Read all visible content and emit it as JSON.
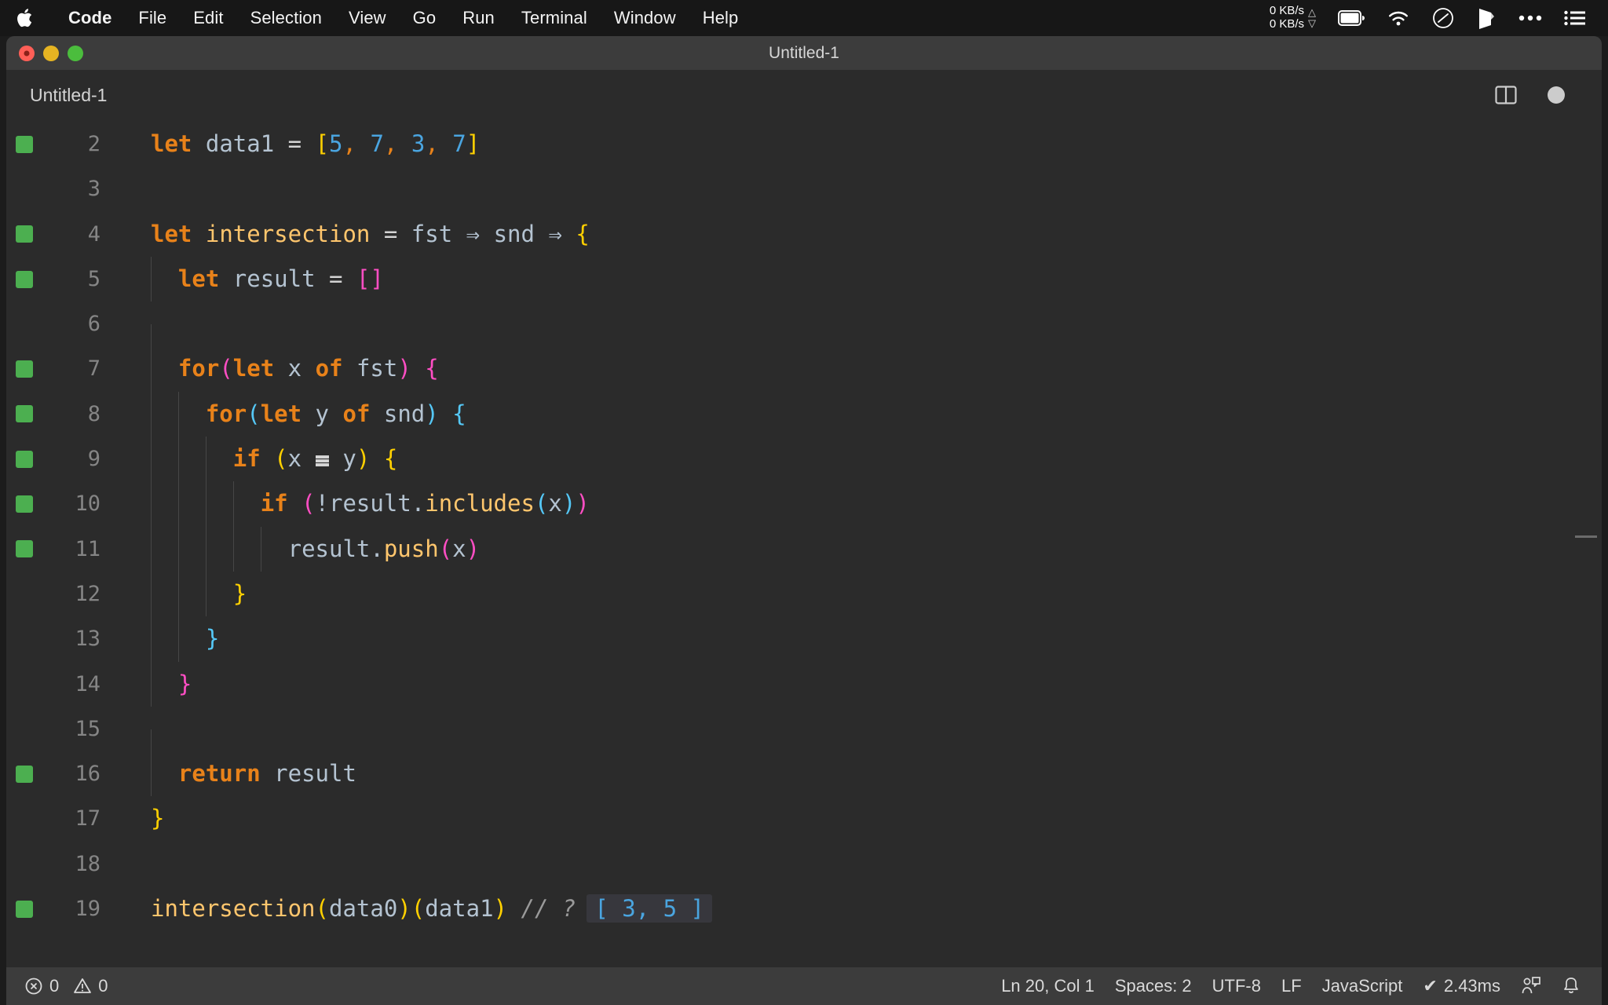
{
  "menubar": {
    "apple_icon": "apple-logo-icon",
    "items": [
      {
        "label": "Code",
        "bold": true
      },
      {
        "label": "File",
        "bold": false
      },
      {
        "label": "Edit",
        "bold": false
      },
      {
        "label": "Selection",
        "bold": false
      },
      {
        "label": "View",
        "bold": false
      },
      {
        "label": "Go",
        "bold": false
      },
      {
        "label": "Run",
        "bold": false
      },
      {
        "label": "Terminal",
        "bold": false
      },
      {
        "label": "Window",
        "bold": false
      },
      {
        "label": "Help",
        "bold": false
      }
    ],
    "network": {
      "up": "0 KB/s",
      "down": "0 KB/s"
    },
    "icons": [
      "battery-icon",
      "wifi-icon",
      "control-center-icon",
      "dropbox-icon",
      "ellipsis-icon",
      "list-icon"
    ]
  },
  "window": {
    "title": "Untitled-1",
    "traffic_lights": [
      "close-button",
      "minimize-button",
      "maximize-button"
    ]
  },
  "tabbar": {
    "tabs": [
      {
        "label": "Untitled-1",
        "active": true,
        "dirty": true
      }
    ],
    "actions": [
      "split-editor-icon",
      "unsaved-indicator"
    ]
  },
  "editor": {
    "language": "JavaScript",
    "lines": [
      {
        "number": "2",
        "quokka": true,
        "indent": 0,
        "tokens": [
          {
            "t": "let",
            "c": "kw"
          },
          {
            "t": " ",
            "c": "op"
          },
          {
            "t": "data1",
            "c": "var"
          },
          {
            "t": " ",
            "c": "op"
          },
          {
            "t": "=",
            "c": "op"
          },
          {
            "t": " ",
            "c": "op"
          },
          {
            "t": "[",
            "c": "b3"
          },
          {
            "t": "5",
            "c": "num"
          },
          {
            "t": ",",
            "c": "comma"
          },
          {
            "t": " ",
            "c": "op"
          },
          {
            "t": "7",
            "c": "num"
          },
          {
            "t": ",",
            "c": "comma"
          },
          {
            "t": " ",
            "c": "op"
          },
          {
            "t": "3",
            "c": "num"
          },
          {
            "t": ",",
            "c": "comma"
          },
          {
            "t": " ",
            "c": "op"
          },
          {
            "t": "7",
            "c": "num"
          },
          {
            "t": "]",
            "c": "b3"
          }
        ]
      },
      {
        "number": "3",
        "quokka": false,
        "indent": 0,
        "tokens": []
      },
      {
        "number": "4",
        "quokka": true,
        "indent": 0,
        "tokens": [
          {
            "t": "let",
            "c": "kw"
          },
          {
            "t": " ",
            "c": "op"
          },
          {
            "t": "intersection",
            "c": "fn"
          },
          {
            "t": " ",
            "c": "op"
          },
          {
            "t": "=",
            "c": "op"
          },
          {
            "t": " ",
            "c": "op"
          },
          {
            "t": "fst",
            "c": "var"
          },
          {
            "t": " ",
            "c": "op"
          },
          {
            "t": "⇒",
            "c": "arrow-fat"
          },
          {
            "t": " ",
            "c": "op"
          },
          {
            "t": "snd",
            "c": "var"
          },
          {
            "t": " ",
            "c": "op"
          },
          {
            "t": "⇒",
            "c": "arrow-fat"
          },
          {
            "t": " ",
            "c": "op"
          },
          {
            "t": "{",
            "c": "b3"
          }
        ]
      },
      {
        "number": "5",
        "quokka": true,
        "indent": 1,
        "tokens": [
          {
            "t": "  ",
            "c": "op"
          },
          {
            "t": "let",
            "c": "kw"
          },
          {
            "t": " ",
            "c": "op"
          },
          {
            "t": "result",
            "c": "var"
          },
          {
            "t": " ",
            "c": "op"
          },
          {
            "t": "=",
            "c": "op"
          },
          {
            "t": " ",
            "c": "op"
          },
          {
            "t": "[]",
            "c": "b1"
          }
        ]
      },
      {
        "number": "6",
        "quokka": false,
        "indent": 1,
        "tokens": []
      },
      {
        "number": "7",
        "quokka": true,
        "indent": 1,
        "tokens": [
          {
            "t": "  ",
            "c": "op"
          },
          {
            "t": "for",
            "c": "kw"
          },
          {
            "t": "(",
            "c": "b1"
          },
          {
            "t": "let",
            "c": "kw"
          },
          {
            "t": " x ",
            "c": "var"
          },
          {
            "t": "of",
            "c": "kw2"
          },
          {
            "t": " ",
            "c": "op"
          },
          {
            "t": "fst",
            "c": "var"
          },
          {
            "t": ")",
            "c": "b1"
          },
          {
            "t": " ",
            "c": "op"
          },
          {
            "t": "{",
            "c": "b1"
          }
        ]
      },
      {
        "number": "8",
        "quokka": true,
        "indent": 2,
        "tokens": [
          {
            "t": "    ",
            "c": "op"
          },
          {
            "t": "for",
            "c": "kw"
          },
          {
            "t": "(",
            "c": "b2"
          },
          {
            "t": "let",
            "c": "kw"
          },
          {
            "t": " y ",
            "c": "var"
          },
          {
            "t": "of",
            "c": "kw2"
          },
          {
            "t": " ",
            "c": "op"
          },
          {
            "t": "snd",
            "c": "var"
          },
          {
            "t": ")",
            "c": "b2"
          },
          {
            "t": " ",
            "c": "op"
          },
          {
            "t": "{",
            "c": "b2"
          }
        ]
      },
      {
        "number": "9",
        "quokka": true,
        "indent": 3,
        "tokens": [
          {
            "t": "      ",
            "c": "op"
          },
          {
            "t": "if",
            "c": "kw"
          },
          {
            "t": " ",
            "c": "op"
          },
          {
            "t": "(",
            "c": "b3"
          },
          {
            "t": "x",
            "c": "var"
          },
          {
            "t": " ",
            "c": "op"
          },
          {
            "t": "===",
            "c": "eq3marker"
          },
          {
            "t": " ",
            "c": "op"
          },
          {
            "t": "y",
            "c": "var"
          },
          {
            "t": ")",
            "c": "b3"
          },
          {
            "t": " ",
            "c": "op"
          },
          {
            "t": "{",
            "c": "b3"
          }
        ]
      },
      {
        "number": "10",
        "quokka": true,
        "indent": 4,
        "tokens": [
          {
            "t": "        ",
            "c": "op"
          },
          {
            "t": "if",
            "c": "kw"
          },
          {
            "t": " ",
            "c": "op"
          },
          {
            "t": "(",
            "c": "b1"
          },
          {
            "t": "!",
            "c": "var"
          },
          {
            "t": "result",
            "c": "var"
          },
          {
            "t": ".",
            "c": "var"
          },
          {
            "t": "includes",
            "c": "fn"
          },
          {
            "t": "(",
            "c": "b2"
          },
          {
            "t": "x",
            "c": "var"
          },
          {
            "t": ")",
            "c": "b2"
          },
          {
            "t": ")",
            "c": "b1"
          }
        ]
      },
      {
        "number": "11",
        "quokka": true,
        "indent": 5,
        "tokens": [
          {
            "t": "          ",
            "c": "op"
          },
          {
            "t": "result",
            "c": "var"
          },
          {
            "t": ".",
            "c": "var"
          },
          {
            "t": "push",
            "c": "fn"
          },
          {
            "t": "(",
            "c": "b1"
          },
          {
            "t": "x",
            "c": "var"
          },
          {
            "t": ")",
            "c": "b1"
          }
        ]
      },
      {
        "number": "12",
        "quokka": false,
        "indent": 3,
        "tokens": [
          {
            "t": "      ",
            "c": "op"
          },
          {
            "t": "}",
            "c": "b3"
          }
        ]
      },
      {
        "number": "13",
        "quokka": false,
        "indent": 2,
        "tokens": [
          {
            "t": "    ",
            "c": "op"
          },
          {
            "t": "}",
            "c": "b2"
          }
        ]
      },
      {
        "number": "14",
        "quokka": false,
        "indent": 1,
        "tokens": [
          {
            "t": "  ",
            "c": "op"
          },
          {
            "t": "}",
            "c": "b1"
          }
        ]
      },
      {
        "number": "15",
        "quokka": false,
        "indent": 1,
        "tokens": []
      },
      {
        "number": "16",
        "quokka": true,
        "indent": 1,
        "tokens": [
          {
            "t": "  ",
            "c": "op"
          },
          {
            "t": "return",
            "c": "kw"
          },
          {
            "t": " ",
            "c": "op"
          },
          {
            "t": "result",
            "c": "var"
          }
        ]
      },
      {
        "number": "17",
        "quokka": false,
        "indent": 0,
        "tokens": [
          {
            "t": "}",
            "c": "b3"
          }
        ]
      },
      {
        "number": "18",
        "quokka": false,
        "indent": 0,
        "tokens": []
      },
      {
        "number": "19",
        "quokka": true,
        "indent": 0,
        "inline_result": "[ 3, 5 ]",
        "tokens": [
          {
            "t": "intersection",
            "c": "fn"
          },
          {
            "t": "(",
            "c": "b3"
          },
          {
            "t": "data0",
            "c": "var"
          },
          {
            "t": ")",
            "c": "b3"
          },
          {
            "t": "(",
            "c": "b3"
          },
          {
            "t": "data1",
            "c": "var"
          },
          {
            "t": ")",
            "c": "b3"
          },
          {
            "t": " ",
            "c": "op"
          },
          {
            "t": "// ?",
            "c": "comment"
          }
        ]
      }
    ]
  },
  "statusbar": {
    "errors": "0",
    "warnings": "0",
    "position": "Ln 20, Col 1",
    "indentation": "Spaces: 2",
    "encoding": "UTF-8",
    "eol": "LF",
    "language": "JavaScript",
    "quokka_time": "2.43ms",
    "quokka_check": "✔",
    "right_icons": [
      "feedback-icon",
      "bell-icon"
    ]
  },
  "colors": {
    "editor_bg": "#2b2b2b",
    "titlebar_bg": "#3c3c3c",
    "keyword": "#e8821a",
    "function": "#ffc66d",
    "number": "#4aa5e0",
    "variable": "#b4c3d1",
    "bracket1": "#ff4ec4",
    "bracket2": "#55c8f7",
    "bracket3": "#ffd000",
    "comment": "#9a9a9a",
    "quokka_green": "#4caf50"
  }
}
